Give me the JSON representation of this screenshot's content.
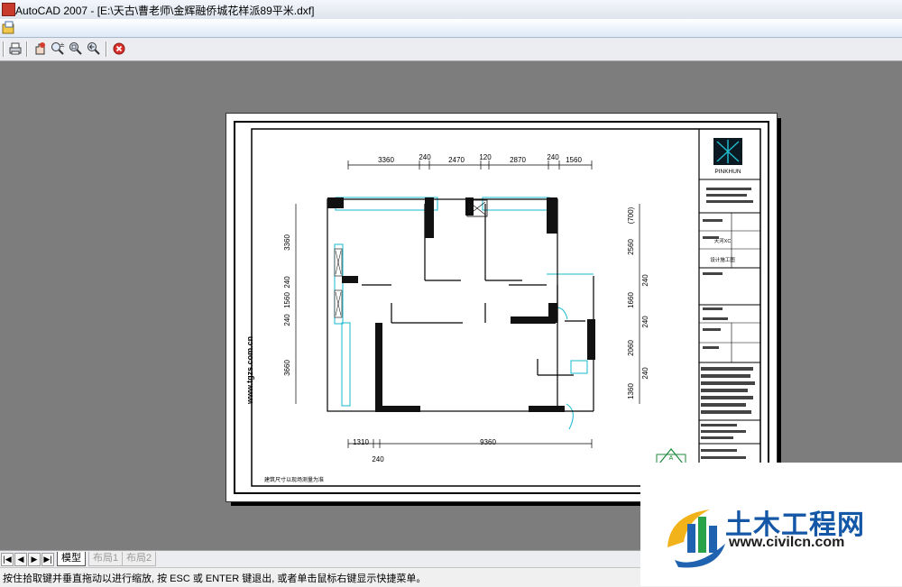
{
  "window": {
    "title": "AutoCAD 2007 - [E:\\天古\\曹老师\\金辉融侨城花样派89平米.dxf]"
  },
  "toolbar": {
    "buttons": [
      {
        "name": "print-icon"
      },
      {
        "name": "pan-icon"
      },
      {
        "name": "zoom-realtime-icon"
      },
      {
        "name": "zoom-window-icon"
      },
      {
        "name": "zoom-previous-icon"
      },
      {
        "name": "close-preview-icon"
      }
    ]
  },
  "drawing": {
    "top_dims": [
      "3360",
      "240",
      "2470",
      "120",
      "2870",
      "240",
      "1560"
    ],
    "bottom_dims": [
      "1310",
      "9360"
    ],
    "bottom_sub_dim": "240",
    "left_dims": [
      "3360",
      "240",
      "1560",
      "240",
      "3660"
    ],
    "right_dims": [
      "(700)",
      "2560",
      "240",
      "1660",
      "240",
      "2060",
      "240",
      "1360"
    ],
    "vertical_url": "www.tgzs.com.cn",
    "caption": "建筑尺寸以现场测量为准",
    "titleblock": {
      "logo_text": "PINKHUN",
      "cells": [
        "天河XC",
        "设计施工图"
      ]
    },
    "badge": "A"
  },
  "tabs": {
    "model": "模型",
    "layout1": "布局1",
    "layout2": "布局2"
  },
  "status": {
    "text": "按住拾取键并垂直拖动以进行缩放, 按 ESC 或 ENTER 键退出, 或者单击鼠标右键显示快捷菜单。"
  },
  "watermark": {
    "name": "土木工程网",
    "url": "www.civilcn.com"
  }
}
